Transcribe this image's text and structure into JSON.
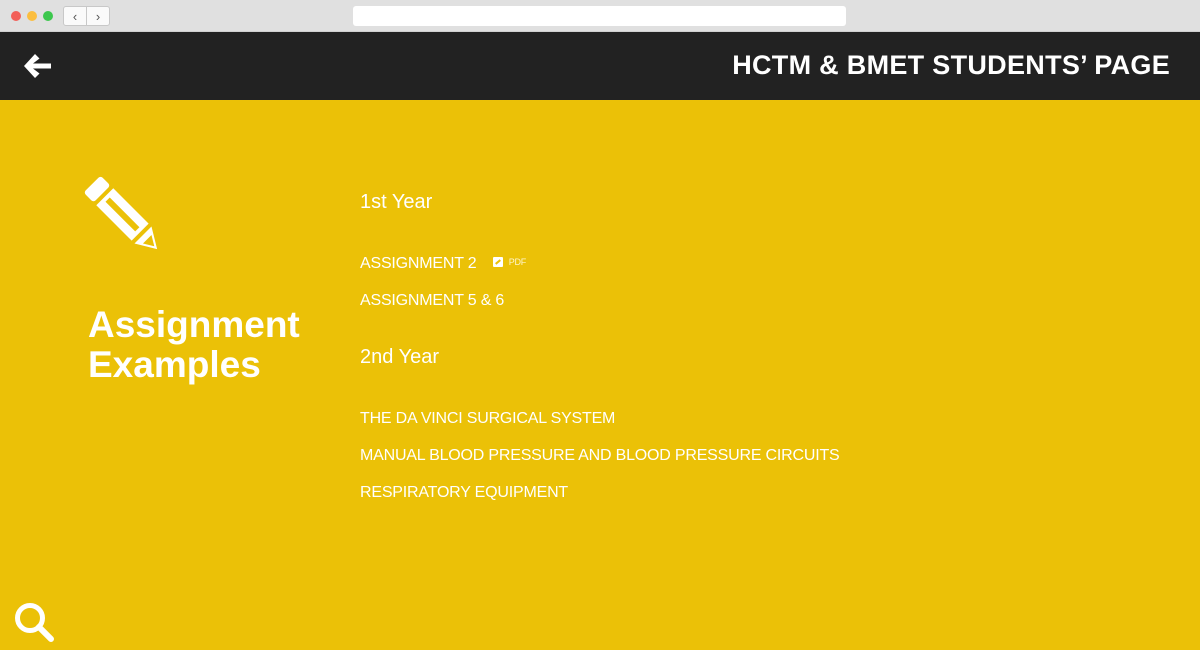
{
  "browser": {
    "back_glyph": "‹",
    "forward_glyph": "›",
    "url": ""
  },
  "header": {
    "back_icon": "arrow-left-icon",
    "title": "HCTM & BMET STUDENTS’ PAGE"
  },
  "main": {
    "icon": "pencil-icon",
    "title_line1": "Assignment",
    "title_line2": "Examples",
    "sections": [
      {
        "heading": "1st Year",
        "links": [
          {
            "label": "ASSIGNMENT 2",
            "badge": "PDF"
          },
          {
            "label": "ASSIGNMENT 5 & 6"
          }
        ]
      },
      {
        "heading": "2nd Year",
        "links": [
          {
            "label": "THE DA VINCI SURGICAL SYSTEM"
          },
          {
            "label": "MANUAL BLOOD PRESSURE AND BLOOD PRESSURE CIRCUITS"
          },
          {
            "label": "RESPIRATORY EQUIPMENT"
          }
        ]
      }
    ],
    "search_icon": "search-icon"
  },
  "colors": {
    "background": "#ebc107",
    "header": "#222222",
    "text": "#ffffff"
  }
}
